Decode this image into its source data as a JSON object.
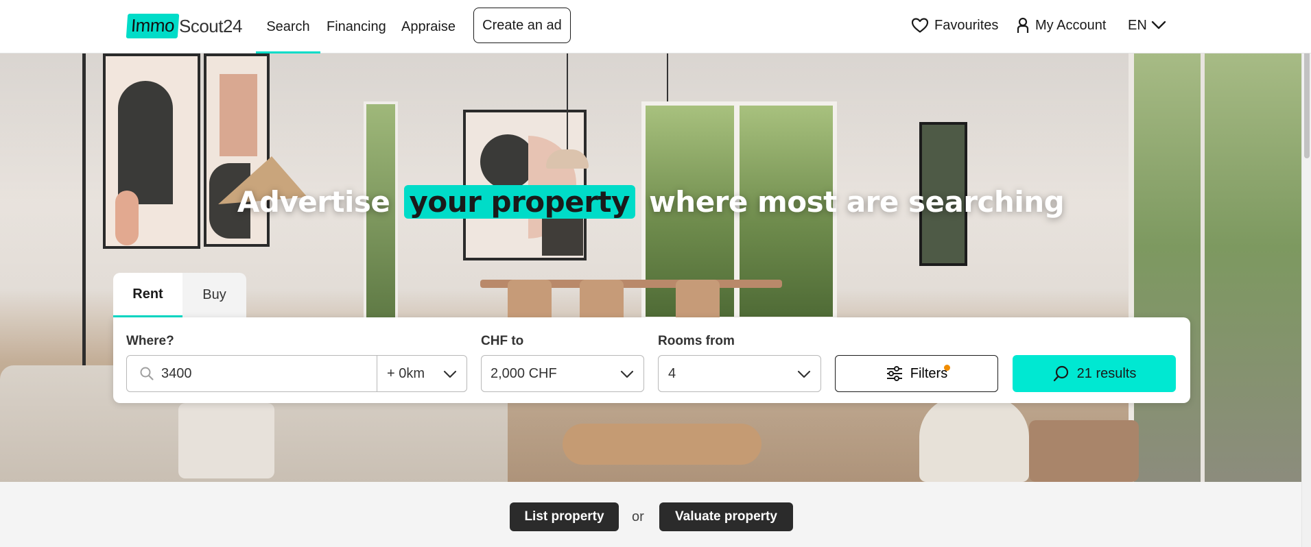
{
  "header": {
    "logo": {
      "part1": "Immo",
      "part2": "Scout24"
    },
    "nav": [
      {
        "label": "Search",
        "active": true
      },
      {
        "label": "Financing",
        "active": false
      },
      {
        "label": "Appraise",
        "active": false
      }
    ],
    "create_ad": "Create an ad",
    "favourites": "Favourites",
    "account": "My Account",
    "language": "EN"
  },
  "hero": {
    "headline_before": "Advertise",
    "headline_highlight": "your property",
    "headline_after": "where most are searching"
  },
  "search": {
    "tabs": [
      {
        "label": "Rent",
        "active": true
      },
      {
        "label": "Buy",
        "active": false
      }
    ],
    "where_label": "Where?",
    "where_value": "3400",
    "radius_value": "+ 0km",
    "price_label": "CHF to",
    "price_value": "2,000 CHF",
    "rooms_label": "Rooms from",
    "rooms_value": "4",
    "filters_label": "Filters",
    "filters_active": true,
    "results_label": "21 results"
  },
  "bottom": {
    "list_property": "List property",
    "or": "or",
    "valuate_property": "Valuate property"
  },
  "colors": {
    "accent": "#00dcc8",
    "results_button": "#00e8d2",
    "filter_dot": "#f08c00",
    "dark_pill": "#2b2b2b"
  }
}
